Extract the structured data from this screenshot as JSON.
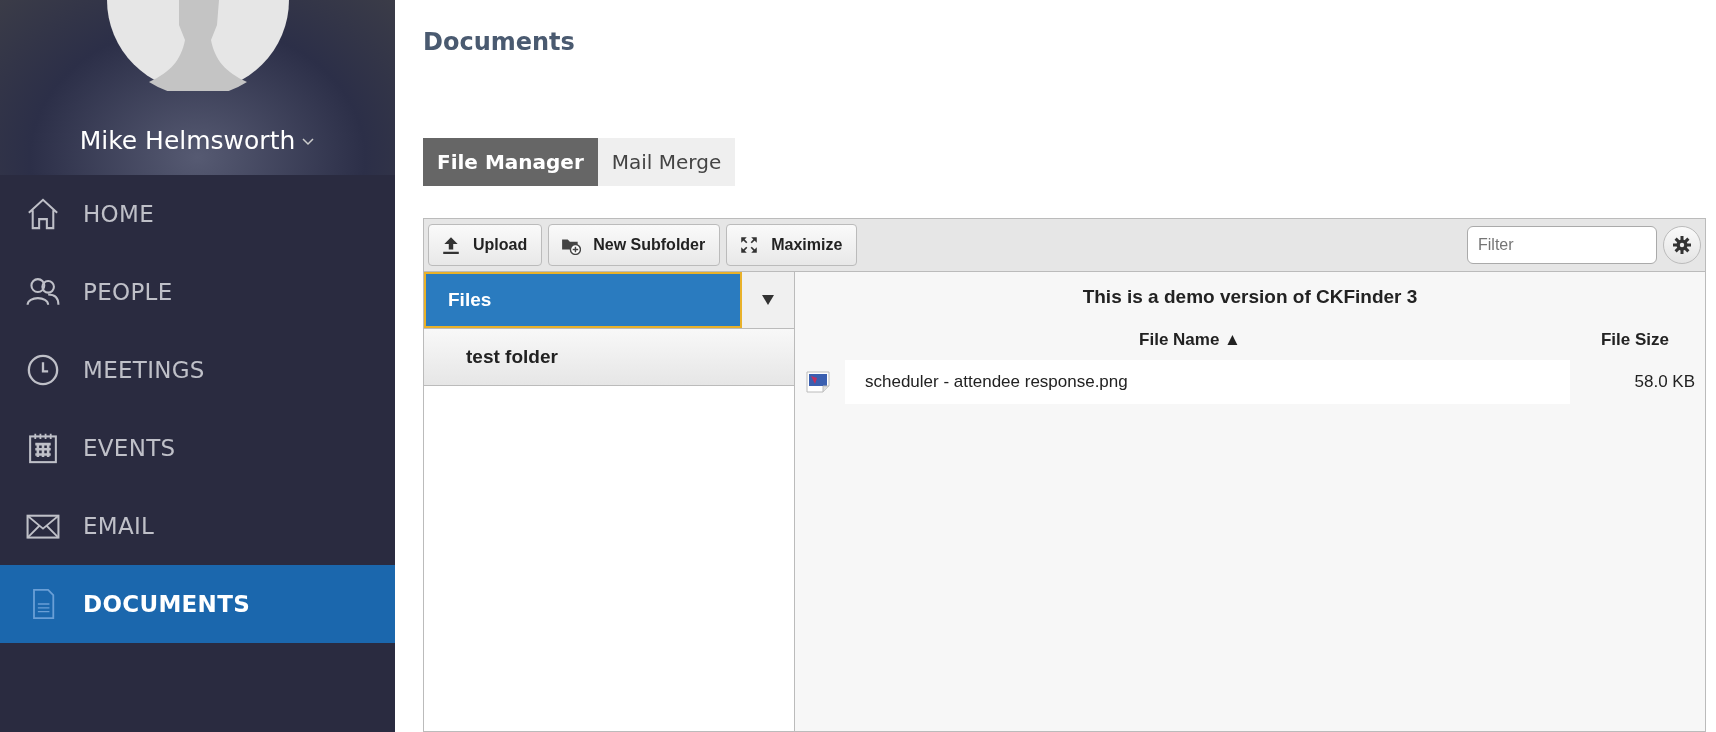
{
  "sidebar": {
    "user": {
      "name": "Mike Helmsworth"
    },
    "items": [
      {
        "label": "HOME",
        "kind": "home",
        "selected": false
      },
      {
        "label": "PEOPLE",
        "kind": "people",
        "selected": false
      },
      {
        "label": "MEETINGS",
        "kind": "meetings",
        "selected": false
      },
      {
        "label": "EVENTS",
        "kind": "events",
        "selected": false
      },
      {
        "label": "EMAIL",
        "kind": "email",
        "selected": false
      },
      {
        "label": "DOCUMENTS",
        "kind": "documents",
        "selected": true
      }
    ]
  },
  "page": {
    "title": "Documents"
  },
  "tabs": [
    {
      "label": "File Manager",
      "selected": true
    },
    {
      "label": "Mail Merge",
      "selected": false
    }
  ],
  "finder": {
    "toolbar": {
      "buttons": [
        {
          "label": "Upload",
          "kind": "upload"
        },
        {
          "label": "New Subfolder",
          "kind": "subfolder"
        },
        {
          "label": "Maximize",
          "kind": "maximize"
        }
      ],
      "filter": {
        "placeholder": "Filter"
      }
    },
    "folders": [
      {
        "label": "Files",
        "selected": true
      },
      {
        "label": "test folder",
        "selected": false
      }
    ],
    "notice": "This is a demo version of CKFinder 3",
    "columns": [
      "File Name ▲",
      "File Size"
    ],
    "rows": [
      {
        "name": "scheduler - attendee response.png",
        "size": "58.0 KB"
      }
    ]
  }
}
